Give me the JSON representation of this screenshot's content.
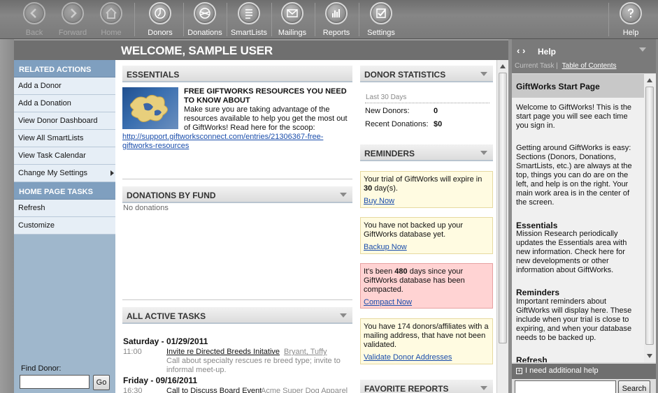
{
  "toolbar": {
    "back": "Back",
    "forward": "Forward",
    "home": "Home",
    "donors": "Donors",
    "donations": "Donations",
    "smartlists": "SmartLists",
    "mailings": "Mailings",
    "reports": "Reports",
    "settings": "Settings",
    "help": "Help"
  },
  "welcome": "WELCOME, SAMPLE USER",
  "sidebar": {
    "related_actions": "RELATED ACTIONS",
    "actions": [
      "Add a Donor",
      "Add a Donation",
      "View Donor Dashboard",
      "View All SmartLists",
      "View Task Calendar",
      "Change My Settings"
    ],
    "home_tasks": "HOME PAGE TASKS",
    "tasks": [
      "Refresh",
      "Customize"
    ],
    "find_donor_label": "Find Donor:",
    "go": "Go"
  },
  "essentials": {
    "title": "ESSENTIALS",
    "headline": "FREE GIFTWORKS RESOURCES YOU NEED TO KNOW ABOUT",
    "text": "Make sure you are taking advantage of the resources available to help you get the most out of GiftWorks! Read here for the scoop:",
    "link": "http://support.giftworksconnect.com/entries/21306367-free-giftworks-resources"
  },
  "donations_by_fund": {
    "title": "DONATIONS BY FUND",
    "empty": "No donations"
  },
  "active_tasks": {
    "title": "ALL ACTIVE TASKS",
    "items": [
      {
        "date": "Saturday - 01/29/2011",
        "time": "11:00",
        "title": "Invite re Directed Breeds Initative",
        "owner": "Bryant, Tuffy",
        "desc": "Call about specialty rescues re breed type; invite to informal meet-up."
      },
      {
        "date": "Friday - 09/16/2011",
        "time": "16:30",
        "title": "Call to Discuss Board Event",
        "owner": "Acme Super Dog Apparel"
      }
    ]
  },
  "donor_stats": {
    "title": "DONOR STATISTICS",
    "period": "Last 30 Days",
    "new_donors_label": "New Donors:",
    "new_donors": "0",
    "recent_donations_label": "Recent Donations:",
    "recent_donations": "$0"
  },
  "reminders": {
    "title": "REMINDERS",
    "trial_a": "Your trial of GiftWorks will expire in ",
    "trial_days": "30",
    "trial_b": " day(s).",
    "trial_link": "Buy Now",
    "backup_text": "You have not backed up your GiftWorks database yet.",
    "backup_link": "Backup Now",
    "compact_a": "It's been ",
    "compact_days": "480",
    "compact_b": " days since your GiftWorks database has been compacted.",
    "compact_link": "Compact Now",
    "validate_text": "You have 174 donors/affiliates with a mailing address, that have not been validated.",
    "validate_link": "Validate Donor Addresses"
  },
  "favorite_reports": {
    "title": "FAVORITE REPORTS"
  },
  "help": {
    "title": "Help",
    "current_task": "Current Task",
    "toc": "Table of Contents",
    "page_title": "GiftWorks Start Page",
    "p1": "Welcome to GiftWorks! This is the start page you will see each time you sign in.",
    "p2": "Getting around GiftWorks is easy: Sections (Donors, Donations, SmartLists, etc.) are always at the top, things you can do are on the left, and help is on the right. Your main work area is in the center of the screen.",
    "h_essentials": "Essentials",
    "p3": "Mission Research periodically updates the Essentials area with new information. Check here for new developments or other information about GiftWorks.",
    "h_reminders": "Reminders",
    "p4": "Important reminders about GiftWorks will display here. These include when your trial is close to expiring, and when your database needs to be backed up.",
    "h_refresh": "Refresh",
    "need_help": "I need additional help",
    "search": "Search"
  }
}
